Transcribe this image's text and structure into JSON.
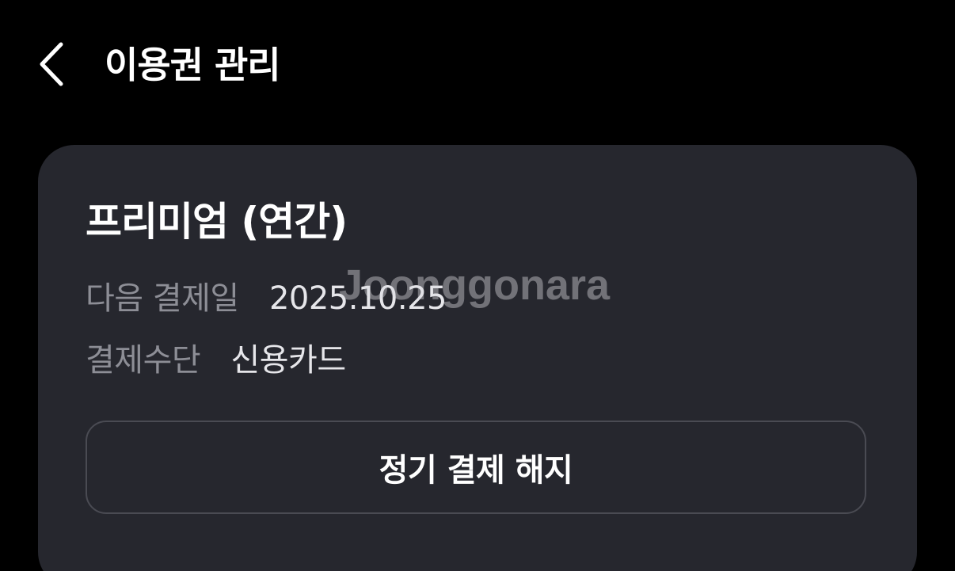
{
  "header": {
    "back_icon": "chevron-left-icon",
    "title": "이용권 관리"
  },
  "subscription": {
    "plan_name": "프리미엄 (연간)",
    "next_payment": {
      "label": "다음 결제일",
      "value": "2025.10.25"
    },
    "payment_method": {
      "label": "결제수단",
      "value": "신용카드"
    },
    "cancel_button_label": "정기 결제 해지"
  },
  "watermark": {
    "text": "Joonggonara"
  },
  "colors": {
    "background": "#000000",
    "card": "#26272e",
    "label": "#8d8e96",
    "value": "#e6e6ea",
    "button_border": "#4a4b53"
  }
}
